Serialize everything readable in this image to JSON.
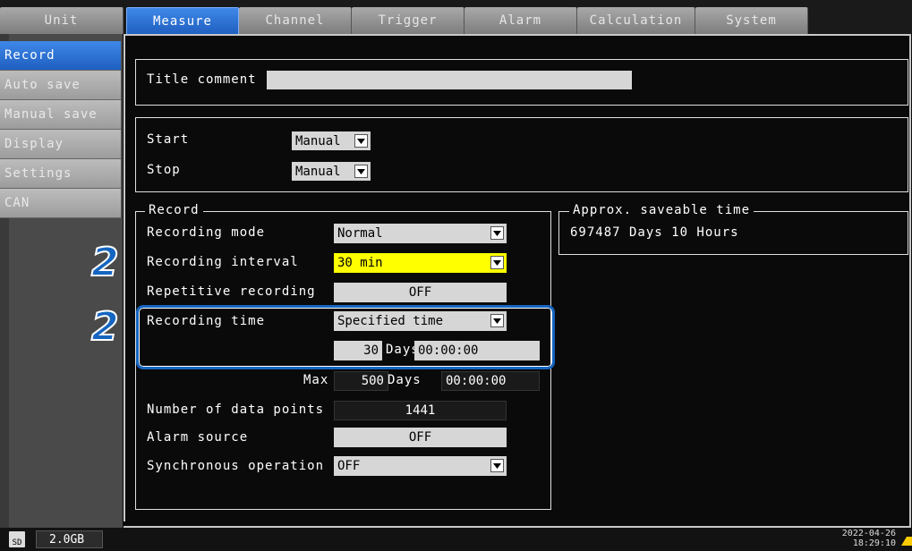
{
  "tabs": [
    {
      "label": "Unit"
    },
    {
      "label": "Measure"
    },
    {
      "label": "Channel"
    },
    {
      "label": "Trigger"
    },
    {
      "label": "Alarm"
    },
    {
      "label": "Calculation"
    },
    {
      "label": "System"
    }
  ],
  "sidebar": {
    "items": [
      {
        "label": "Record"
      },
      {
        "label": "Auto save"
      },
      {
        "label": "Manual save"
      },
      {
        "label": "Display"
      },
      {
        "label": "Settings"
      },
      {
        "label": "CAN"
      }
    ]
  },
  "title_comment": {
    "label": "Title comment",
    "value": ""
  },
  "start_stop": {
    "start_label": "Start",
    "start_value": "Manual",
    "stop_label": "Stop",
    "stop_value": "Manual"
  },
  "record": {
    "legend": "Record",
    "recording_mode_label": "Recording mode",
    "recording_mode_value": "Normal",
    "recording_interval_label": "Recording interval",
    "recording_interval_value": "30 min",
    "repetitive_label": "Repetitive recording",
    "repetitive_value": "OFF",
    "recording_time_label": "Recording time",
    "recording_time_value": "Specified time",
    "days_value": "30",
    "days_unit": "Days",
    "time_value": "00:00:00",
    "max_label": "Max",
    "max_days": "500",
    "max_unit": "Days",
    "max_time": "00:00:00",
    "data_points_label": "Number of data points",
    "data_points_value": "1441",
    "alarm_source_label": "Alarm source",
    "alarm_source_value": "OFF",
    "sync_label": "Synchronous operation",
    "sync_value": "OFF"
  },
  "saveable": {
    "legend": "Approx. saveable time",
    "value": "697487 Days 10 Hours"
  },
  "callouts": {
    "first": "2",
    "second": "2"
  },
  "status": {
    "sd_label": "SD",
    "storage": "2.0GB",
    "date": "2022-04-26",
    "time": "18:29:10"
  },
  "colors": {
    "accent": "#1f5fc0",
    "highlight": "#ffff00",
    "callout": "#1565c0"
  }
}
